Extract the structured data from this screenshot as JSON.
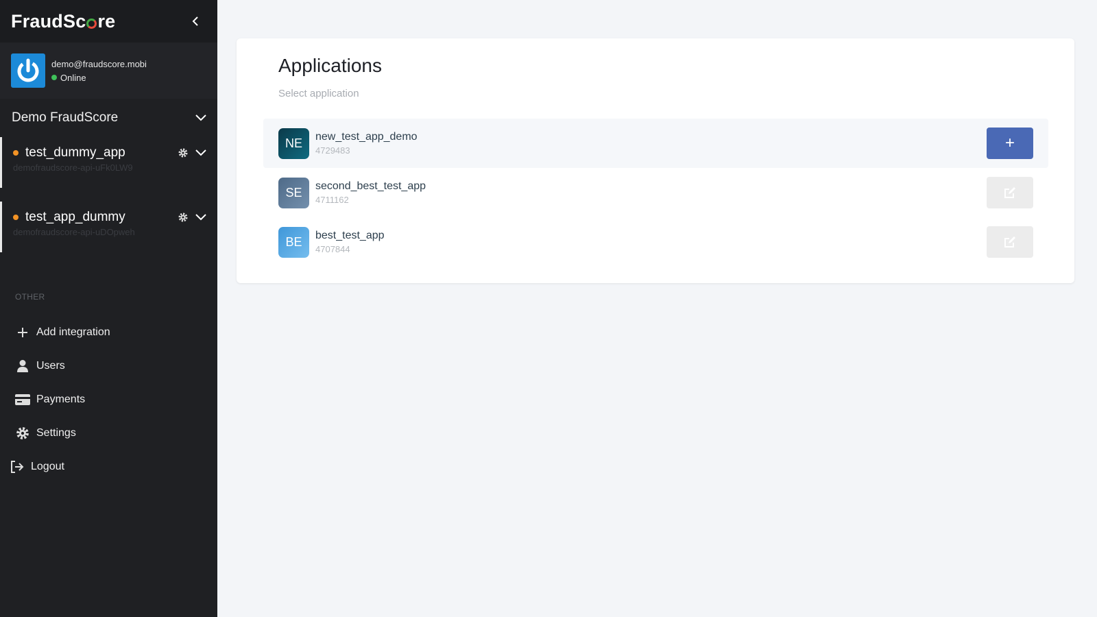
{
  "brand": {
    "prefix": "FraudSc",
    "suffix": "re"
  },
  "user": {
    "email": "demo@fraudscore.mobi",
    "status": "Online"
  },
  "organization": {
    "name": "Demo FraudScore"
  },
  "sidebar_apps": [
    {
      "name": "test_dummy_app",
      "subtitle": "demofraudscore-api-uFk0LW9"
    },
    {
      "name": "test_app_dummy",
      "subtitle": "demofraudscore-api-uDOpweh"
    }
  ],
  "section_label": "OTHER",
  "nav": {
    "add_integration": "Add integration",
    "users": "Users",
    "payments": "Payments",
    "settings": "Settings",
    "logout": "Logout"
  },
  "main": {
    "title": "Applications",
    "subtitle": "Select application",
    "applications": [
      {
        "initials": "NE",
        "name": "new_test_app_demo",
        "id": "4729483",
        "action": "+",
        "badge_color": "#0d4c5f"
      },
      {
        "initials": "SE",
        "name": "second_best_test_app",
        "id": "4711162",
        "badge_color": "#5b7895"
      },
      {
        "initials": "BE",
        "name": "best_test_app",
        "id": "4707844",
        "badge_color": "#5aaae3"
      }
    ]
  },
  "colors": {
    "sidebar_bg": "#1f2023",
    "accent_primary": "#4a69b5",
    "online": "#3fc15a",
    "app_dot": "#f39325"
  }
}
